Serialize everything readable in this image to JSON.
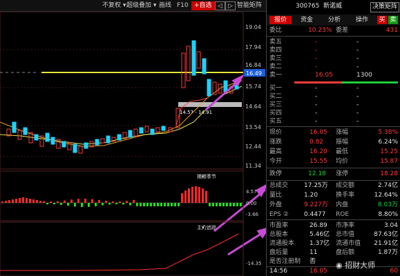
{
  "toolbar": {
    "items": [
      "不复权",
      "超级叠加",
      "画线",
      "F10",
      "+自选",
      "◁",
      "▷",
      "智能矩阵"
    ],
    "dropdown_icons": true
  },
  "chart": {
    "price_axis": [
      "19.04",
      "17.94",
      "16.84",
      "16.49",
      "15.74",
      "14.64",
      "13.54",
      "12.44",
      "11.34",
      "10.24"
    ],
    "range_label": "14.57 - 14.91",
    "indicator1_title": "捕捞季节",
    "indicator1_axis": [
      "4.57",
      "0.00",
      "-3.66"
    ],
    "indicator2_title": "主力追踪",
    "indicator2_axis": [
      "-14.35"
    ],
    "current_price_label": "16.49"
  },
  "stock": {
    "code": "300765",
    "name": "新诺威",
    "matrix_button": "决策矩阵"
  },
  "tabs": [
    "报价",
    "资金",
    "分析",
    "操作"
  ],
  "buy_sell_buttons": [
    "买",
    "卖"
  ],
  "ratio": {
    "weibi_label": "委比",
    "weibi_value": "10.23%",
    "weicha_label": "委差",
    "weicha_value": "431"
  },
  "order_book": {
    "sell": [
      {
        "label": "卖五",
        "price": "-",
        "vol": "-"
      },
      {
        "label": "卖四",
        "price": "-",
        "vol": "-"
      },
      {
        "label": "卖三",
        "price": "-",
        "vol": "-"
      },
      {
        "label": "卖二",
        "price": "-",
        "vol": "-"
      },
      {
        "label": "卖一",
        "price": "16.05",
        "vol": "1300"
      }
    ],
    "buy": [
      {
        "label": "买一",
        "price": "-",
        "vol": "-"
      },
      {
        "label": "买二",
        "price": "-",
        "vol": "-"
      },
      {
        "label": "买三",
        "price": "-",
        "vol": "-"
      },
      {
        "label": "买四",
        "price": "-",
        "vol": "-"
      },
      {
        "label": "买五",
        "price": "-",
        "vol": "-"
      }
    ]
  },
  "quote": [
    {
      "l1": "现价",
      "v1": "16.05",
      "c1": "red",
      "l2": "涨幅",
      "v2": "5.38%",
      "c2": "red"
    },
    {
      "l1": "涨跌",
      "v1": "0.82",
      "c1": "red",
      "l2": "振幅",
      "v2": "6.24%",
      "c2": "white"
    },
    {
      "l1": "最高",
      "v1": "16.20",
      "c1": "red",
      "l2": "最低",
      "v2": "15.25",
      "c2": "red"
    },
    {
      "l1": "今开",
      "v1": "15.55",
      "c1": "red",
      "l2": "均价",
      "v2": "15.87",
      "c2": "red"
    }
  ],
  "limits": {
    "l1": "跌停",
    "v1": "12.18",
    "l2": "涨停",
    "v2": "18.28"
  },
  "volume": [
    {
      "l1": "总成交",
      "v1": "17.25万",
      "c1": "white",
      "l2": "成交额",
      "v2": "2.74亿",
      "c2": "white"
    },
    {
      "l1": "量比",
      "v1": "1.20",
      "c1": "white",
      "l2": "换手率",
      "v2": "12.64%",
      "c2": "white"
    },
    {
      "l1": "外盘",
      "v1": "9.227万",
      "c1": "red",
      "l2": "内盘",
      "v2": "8.03万",
      "c2": "green"
    },
    {
      "l1": "EPS ②",
      "v1": "0.4477",
      "c1": "white",
      "l2": "ROE",
      "v2": "8.80%",
      "c2": "white"
    }
  ],
  "fundamentals": [
    {
      "l1": "市盈率",
      "v1": "26.89",
      "l2": "市净率",
      "v2": "3.04"
    },
    {
      "l1": "总股本",
      "v1": "5.46亿",
      "l2": "总市值",
      "v2": "87.63亿"
    },
    {
      "l1": "流通股本",
      "v1": "1.37亿",
      "l2": "流通市值",
      "v2": "21.91亿"
    },
    {
      "l1": "盘后量",
      "v1": "11",
      "l2": "盘后额",
      "v2": "1.87万"
    },
    {
      "l1": "是否注册制",
      "v1": "否",
      "l2": "",
      "v2": ""
    }
  ],
  "tick": {
    "time": "14:56",
    "price": "16.05",
    "vol": "60"
  },
  "watermark": "招财大师",
  "colors": {
    "up": "#ff3b3b",
    "down": "#1fcf3a",
    "accent": "#c00000",
    "yellow_line": "#e8e83a",
    "arrow": "#c84bd6"
  }
}
